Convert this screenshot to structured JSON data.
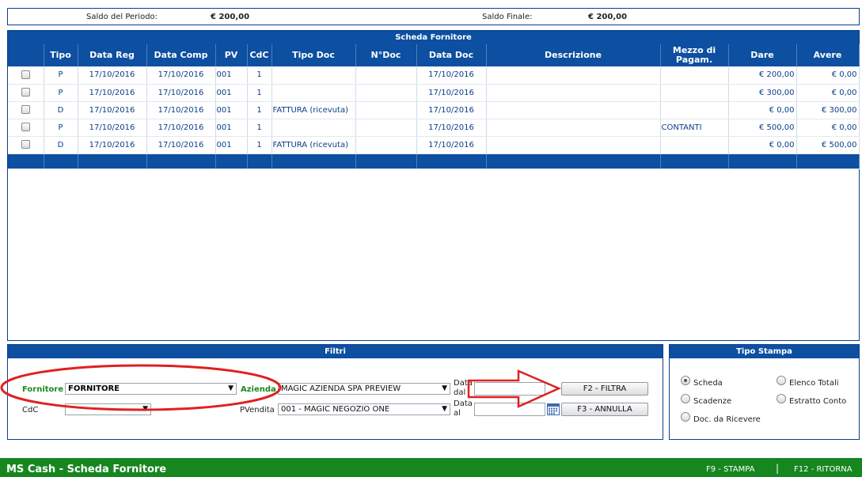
{
  "saldo": {
    "periodo_label": "Saldo del Periodo:",
    "periodo_value": "€ 200,00",
    "finale_label": "Saldo Finale:",
    "finale_value": "€ 200,00"
  },
  "scheda": {
    "title": "Scheda Fornitore",
    "columns": [
      "",
      "Tipo",
      "Data Reg",
      "Data Comp",
      "PV",
      "CdC",
      "Tipo Doc",
      "N°Doc",
      "Data Doc",
      "Descrizione",
      "Mezzo di Pagam.",
      "Dare",
      "Avere"
    ],
    "rows": [
      {
        "tipo": "P",
        "data_reg": "17/10/2016",
        "data_comp": "17/10/2016",
        "pv": "001",
        "cdc": "1",
        "tipo_doc": "",
        "ndoc": "",
        "data_doc": "17/10/2016",
        "descrizione": "",
        "mezzo": "",
        "dare": "€ 200,00",
        "avere": "€ 0,00"
      },
      {
        "tipo": "P",
        "data_reg": "17/10/2016",
        "data_comp": "17/10/2016",
        "pv": "001",
        "cdc": "1",
        "tipo_doc": "",
        "ndoc": "",
        "data_doc": "17/10/2016",
        "descrizione": "",
        "mezzo": "",
        "dare": "€ 300,00",
        "avere": "€ 0,00"
      },
      {
        "tipo": "D",
        "data_reg": "17/10/2016",
        "data_comp": "17/10/2016",
        "pv": "001",
        "cdc": "1",
        "tipo_doc": "FATTURA (ricevuta)",
        "ndoc": "",
        "data_doc": "17/10/2016",
        "descrizione": "",
        "mezzo": "",
        "dare": "€ 0,00",
        "avere": "€ 300,00"
      },
      {
        "tipo": "P",
        "data_reg": "17/10/2016",
        "data_comp": "17/10/2016",
        "pv": "001",
        "cdc": "1",
        "tipo_doc": "",
        "ndoc": "",
        "data_doc": "17/10/2016",
        "descrizione": "",
        "mezzo": "CONTANTI",
        "dare": "€ 500,00",
        "avere": "€ 0,00"
      },
      {
        "tipo": "D",
        "data_reg": "17/10/2016",
        "data_comp": "17/10/2016",
        "pv": "001",
        "cdc": "1",
        "tipo_doc": "FATTURA (ricevuta)",
        "ndoc": "",
        "data_doc": "17/10/2016",
        "descrizione": "",
        "mezzo": "",
        "dare": "€ 0,00",
        "avere": "€ 500,00"
      }
    ]
  },
  "filtri": {
    "title": "Filtri",
    "fornitore_label": "Fornitore",
    "fornitore_value": "FORNITORE",
    "cdc_label": "CdC",
    "cdc_value": "",
    "azienda_label": "Azienda",
    "azienda_value": "MAGIC AZIENDA SPA PREVIEW",
    "pvendita_label": "PVendita",
    "pvendita_value": "001 - MAGIC NEGOZIO ONE",
    "data_dal_label_1": "Data",
    "data_dal_label_2": "dal",
    "data_al_label_1": "Data",
    "data_al_label_2": "al",
    "filtra_button": "F2 - FILTRA",
    "annulla_button": "F3 - ANNULLA"
  },
  "tipo_stampa": {
    "title": "Tipo Stampa",
    "options": [
      {
        "label": "Scheda",
        "selected": true
      },
      {
        "label": "Elenco Totali",
        "selected": false
      },
      {
        "label": "Scadenze",
        "selected": false
      },
      {
        "label": "Estratto Conto",
        "selected": false
      },
      {
        "label": "Doc. da Ricevere",
        "selected": false
      }
    ]
  },
  "footer": {
    "title": "MS Cash - Scheda Fornitore",
    "stampa": "F9 - STAMPA",
    "separator": "|",
    "ritorna": "F12 - RITORNA"
  },
  "colors": {
    "header_blue": "#0d4fa0",
    "footer_green": "#16871f",
    "annotation_red": "#e02020"
  }
}
